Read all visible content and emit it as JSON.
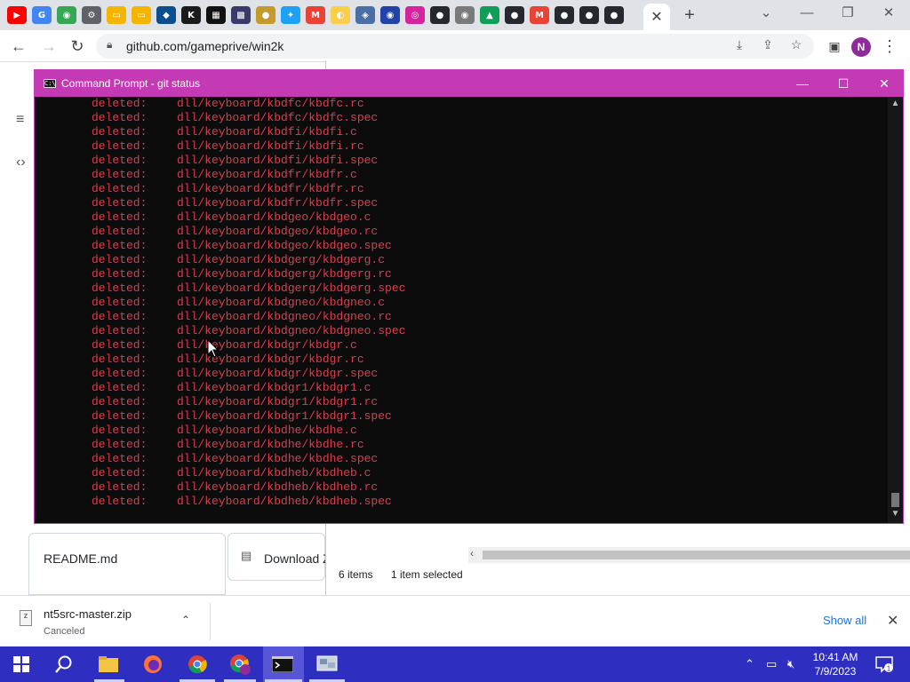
{
  "browser": {
    "url": "github.com/gameprive/win2k",
    "tab_icons": [
      {
        "name": "youtube-icon",
        "color": "#ff0000",
        "glyph": "▶"
      },
      {
        "name": "google-icon",
        "color": "#4285f4",
        "glyph": "G"
      },
      {
        "name": "google-drive-icon",
        "color": "#34a853",
        "glyph": "◉"
      },
      {
        "name": "settings-icon",
        "color": "#5f6368",
        "glyph": "⚙"
      },
      {
        "name": "folder-icon",
        "color": "#f4b400",
        "glyph": "▭"
      },
      {
        "name": "folder-icon",
        "color": "#f4b400",
        "glyph": "▭"
      },
      {
        "name": "remote-desktop-icon",
        "color": "#0a4f8f",
        "glyph": "◆"
      },
      {
        "name": "kim-icon",
        "color": "#1b1b1b",
        "glyph": "K"
      },
      {
        "name": "game-icon",
        "color": "#111111",
        "glyph": "▦"
      },
      {
        "name": "game-icon",
        "color": "#3a3a6a",
        "glyph": "▩"
      },
      {
        "name": "app-icon",
        "color": "#c49a2c",
        "glyph": "●"
      },
      {
        "name": "twitter-icon",
        "color": "#1da1f2",
        "glyph": "✦"
      },
      {
        "name": "gmail-icon",
        "color": "#ea4335",
        "glyph": "M"
      },
      {
        "name": "bulb-icon",
        "color": "#f9ce4b",
        "glyph": "◐"
      },
      {
        "name": "app-icon",
        "color": "#4a6fa5",
        "glyph": "◈"
      },
      {
        "name": "sonic-icon",
        "color": "#2142a8",
        "glyph": "◉"
      },
      {
        "name": "instagram-icon",
        "color": "#d6249f",
        "glyph": "◎"
      },
      {
        "name": "github-icon",
        "color": "#24292f",
        "glyph": "●"
      },
      {
        "name": "chrome-icon",
        "color": "#7a7a7a",
        "glyph": "◉"
      },
      {
        "name": "google-drive-icon",
        "color": "#0f9d58",
        "glyph": "▲"
      },
      {
        "name": "github-icon",
        "color": "#24292f",
        "glyph": "●"
      },
      {
        "name": "gmail-icon",
        "color": "#ea4335",
        "glyph": "M"
      },
      {
        "name": "github-icon",
        "color": "#24292f",
        "glyph": "●"
      },
      {
        "name": "github-icon",
        "color": "#24292f",
        "glyph": "●"
      },
      {
        "name": "github-icon",
        "color": "#24292f",
        "glyph": "●"
      }
    ],
    "profile_initial": "N"
  },
  "github": {
    "readme": "README.md",
    "download": "Download ZIP"
  },
  "explorer": {
    "items_count": "6 items",
    "selected": "1 item selected"
  },
  "cmd": {
    "title": "Command Prompt - git  status",
    "icon_text": "C:\\",
    "lines": [
      {
        "status": "deleted:",
        "path": "dll/keyboard/kbdfc/kbdfc.rc"
      },
      {
        "status": "deleted:",
        "path": "dll/keyboard/kbdfc/kbdfc.spec"
      },
      {
        "status": "deleted:",
        "path": "dll/keyboard/kbdfi/kbdfi.c"
      },
      {
        "status": "deleted:",
        "path": "dll/keyboard/kbdfi/kbdfi.rc"
      },
      {
        "status": "deleted:",
        "path": "dll/keyboard/kbdfi/kbdfi.spec"
      },
      {
        "status": "deleted:",
        "path": "dll/keyboard/kbdfr/kbdfr.c"
      },
      {
        "status": "deleted:",
        "path": "dll/keyboard/kbdfr/kbdfr.rc"
      },
      {
        "status": "deleted:",
        "path": "dll/keyboard/kbdfr/kbdfr.spec"
      },
      {
        "status": "deleted:",
        "path": "dll/keyboard/kbdgeo/kbdgeo.c"
      },
      {
        "status": "deleted:",
        "path": "dll/keyboard/kbdgeo/kbdgeo.rc"
      },
      {
        "status": "deleted:",
        "path": "dll/keyboard/kbdgeo/kbdgeo.spec"
      },
      {
        "status": "deleted:",
        "path": "dll/keyboard/kbdgerg/kbdgerg.c"
      },
      {
        "status": "deleted:",
        "path": "dll/keyboard/kbdgerg/kbdgerg.rc"
      },
      {
        "status": "deleted:",
        "path": "dll/keyboard/kbdgerg/kbdgerg.spec"
      },
      {
        "status": "deleted:",
        "path": "dll/keyboard/kbdgneo/kbdgneo.c"
      },
      {
        "status": "deleted:",
        "path": "dll/keyboard/kbdgneo/kbdgneo.rc"
      },
      {
        "status": "deleted:",
        "path": "dll/keyboard/kbdgneo/kbdgneo.spec"
      },
      {
        "status": "deleted:",
        "path": "dll/keyboard/kbdgr/kbdgr.c"
      },
      {
        "status": "deleted:",
        "path": "dll/keyboard/kbdgr/kbdgr.rc"
      },
      {
        "status": "deleted:",
        "path": "dll/keyboard/kbdgr/kbdgr.spec"
      },
      {
        "status": "deleted:",
        "path": "dll/keyboard/kbdgr1/kbdgr1.c"
      },
      {
        "status": "deleted:",
        "path": "dll/keyboard/kbdgr1/kbdgr1.rc"
      },
      {
        "status": "deleted:",
        "path": "dll/keyboard/kbdgr1/kbdgr1.spec"
      },
      {
        "status": "deleted:",
        "path": "dll/keyboard/kbdhe/kbdhe.c"
      },
      {
        "status": "deleted:",
        "path": "dll/keyboard/kbdhe/kbdhe.rc"
      },
      {
        "status": "deleted:",
        "path": "dll/keyboard/kbdhe/kbdhe.spec"
      },
      {
        "status": "deleted:",
        "path": "dll/keyboard/kbdheb/kbdheb.c"
      },
      {
        "status": "deleted:",
        "path": "dll/keyboard/kbdheb/kbdheb.rc"
      },
      {
        "status": "deleted:",
        "path": "dll/keyboard/kbdheb/kbdheb.spec"
      }
    ]
  },
  "download_bar": {
    "filename": "nt5src-master.zip",
    "state": "Canceled",
    "show_all": "Show all"
  },
  "taskbar": {
    "time": "10:41 AM",
    "date": "7/9/2023",
    "notification_count": "1"
  },
  "colors": {
    "cmd_accent": "#c43ab4",
    "deleted_text": "#e43a4e",
    "taskbar": "#2e2ec0",
    "link": "#1a73e8"
  }
}
